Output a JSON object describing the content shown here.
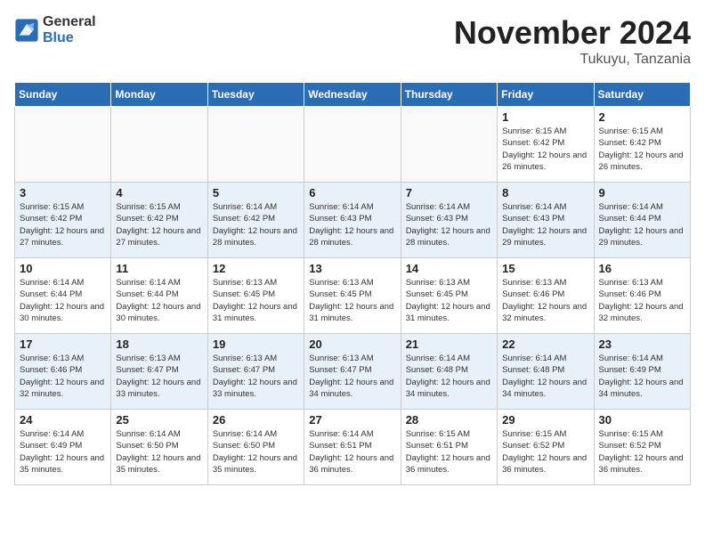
{
  "header": {
    "logo_general": "General",
    "logo_blue": "Blue",
    "month_title": "November 2024",
    "location": "Tukuyu, Tanzania"
  },
  "weekdays": [
    "Sunday",
    "Monday",
    "Tuesday",
    "Wednesday",
    "Thursday",
    "Friday",
    "Saturday"
  ],
  "weeks": [
    [
      {
        "num": "",
        "info": ""
      },
      {
        "num": "",
        "info": ""
      },
      {
        "num": "",
        "info": ""
      },
      {
        "num": "",
        "info": ""
      },
      {
        "num": "",
        "info": ""
      },
      {
        "num": "1",
        "info": "Sunrise: 6:15 AM\nSunset: 6:42 PM\nDaylight: 12 hours and 26 minutes."
      },
      {
        "num": "2",
        "info": "Sunrise: 6:15 AM\nSunset: 6:42 PM\nDaylight: 12 hours and 26 minutes."
      }
    ],
    [
      {
        "num": "3",
        "info": "Sunrise: 6:15 AM\nSunset: 6:42 PM\nDaylight: 12 hours and 27 minutes."
      },
      {
        "num": "4",
        "info": "Sunrise: 6:15 AM\nSunset: 6:42 PM\nDaylight: 12 hours and 27 minutes."
      },
      {
        "num": "5",
        "info": "Sunrise: 6:14 AM\nSunset: 6:42 PM\nDaylight: 12 hours and 28 minutes."
      },
      {
        "num": "6",
        "info": "Sunrise: 6:14 AM\nSunset: 6:43 PM\nDaylight: 12 hours and 28 minutes."
      },
      {
        "num": "7",
        "info": "Sunrise: 6:14 AM\nSunset: 6:43 PM\nDaylight: 12 hours and 28 minutes."
      },
      {
        "num": "8",
        "info": "Sunrise: 6:14 AM\nSunset: 6:43 PM\nDaylight: 12 hours and 29 minutes."
      },
      {
        "num": "9",
        "info": "Sunrise: 6:14 AM\nSunset: 6:44 PM\nDaylight: 12 hours and 29 minutes."
      }
    ],
    [
      {
        "num": "10",
        "info": "Sunrise: 6:14 AM\nSunset: 6:44 PM\nDaylight: 12 hours and 30 minutes."
      },
      {
        "num": "11",
        "info": "Sunrise: 6:14 AM\nSunset: 6:44 PM\nDaylight: 12 hours and 30 minutes."
      },
      {
        "num": "12",
        "info": "Sunrise: 6:13 AM\nSunset: 6:45 PM\nDaylight: 12 hours and 31 minutes."
      },
      {
        "num": "13",
        "info": "Sunrise: 6:13 AM\nSunset: 6:45 PM\nDaylight: 12 hours and 31 minutes."
      },
      {
        "num": "14",
        "info": "Sunrise: 6:13 AM\nSunset: 6:45 PM\nDaylight: 12 hours and 31 minutes."
      },
      {
        "num": "15",
        "info": "Sunrise: 6:13 AM\nSunset: 6:46 PM\nDaylight: 12 hours and 32 minutes."
      },
      {
        "num": "16",
        "info": "Sunrise: 6:13 AM\nSunset: 6:46 PM\nDaylight: 12 hours and 32 minutes."
      }
    ],
    [
      {
        "num": "17",
        "info": "Sunrise: 6:13 AM\nSunset: 6:46 PM\nDaylight: 12 hours and 32 minutes."
      },
      {
        "num": "18",
        "info": "Sunrise: 6:13 AM\nSunset: 6:47 PM\nDaylight: 12 hours and 33 minutes."
      },
      {
        "num": "19",
        "info": "Sunrise: 6:13 AM\nSunset: 6:47 PM\nDaylight: 12 hours and 33 minutes."
      },
      {
        "num": "20",
        "info": "Sunrise: 6:13 AM\nSunset: 6:47 PM\nDaylight: 12 hours and 34 minutes."
      },
      {
        "num": "21",
        "info": "Sunrise: 6:14 AM\nSunset: 6:48 PM\nDaylight: 12 hours and 34 minutes."
      },
      {
        "num": "22",
        "info": "Sunrise: 6:14 AM\nSunset: 6:48 PM\nDaylight: 12 hours and 34 minutes."
      },
      {
        "num": "23",
        "info": "Sunrise: 6:14 AM\nSunset: 6:49 PM\nDaylight: 12 hours and 34 minutes."
      }
    ],
    [
      {
        "num": "24",
        "info": "Sunrise: 6:14 AM\nSunset: 6:49 PM\nDaylight: 12 hours and 35 minutes."
      },
      {
        "num": "25",
        "info": "Sunrise: 6:14 AM\nSunset: 6:50 PM\nDaylight: 12 hours and 35 minutes."
      },
      {
        "num": "26",
        "info": "Sunrise: 6:14 AM\nSunset: 6:50 PM\nDaylight: 12 hours and 35 minutes."
      },
      {
        "num": "27",
        "info": "Sunrise: 6:14 AM\nSunset: 6:51 PM\nDaylight: 12 hours and 36 minutes."
      },
      {
        "num": "28",
        "info": "Sunrise: 6:15 AM\nSunset: 6:51 PM\nDaylight: 12 hours and 36 minutes."
      },
      {
        "num": "29",
        "info": "Sunrise: 6:15 AM\nSunset: 6:52 PM\nDaylight: 12 hours and 36 minutes."
      },
      {
        "num": "30",
        "info": "Sunrise: 6:15 AM\nSunset: 6:52 PM\nDaylight: 12 hours and 36 minutes."
      }
    ]
  ]
}
